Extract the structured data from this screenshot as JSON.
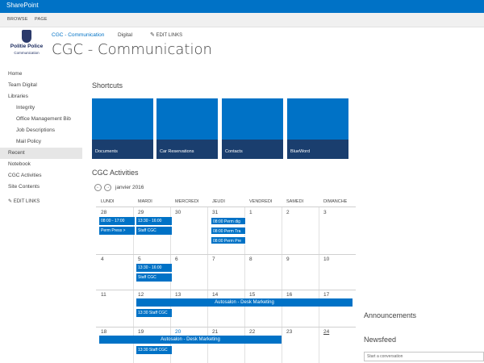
{
  "suite": {
    "title": "SharePoint"
  },
  "ribbon": {
    "tabs": [
      "BROWSE",
      "PAGE"
    ]
  },
  "logo": {
    "line1": "Politie Police",
    "line2": "Communication"
  },
  "topnav": {
    "items": [
      "CGC - Communication",
      "Digital"
    ],
    "edit": "EDIT LINKS"
  },
  "site": {
    "title": "CGC - Communication"
  },
  "leftnav": {
    "items": [
      {
        "label": "Home",
        "level": "top"
      },
      {
        "label": "Team Digital",
        "level": "top"
      },
      {
        "label": "Libraries",
        "level": "top"
      },
      {
        "label": "Integrity",
        "level": "sub"
      },
      {
        "label": "Office Management Bib",
        "level": "sub"
      },
      {
        "label": "Job Descriptions",
        "level": "sub"
      },
      {
        "label": "Mail Policy",
        "level": "sub"
      },
      {
        "label": "Recent",
        "level": "top",
        "selected": true
      },
      {
        "label": "Notebook",
        "level": "top"
      },
      {
        "label": "CGC Activities",
        "level": "top"
      },
      {
        "label": "Site Contents",
        "level": "top"
      }
    ],
    "edit": "EDIT LINKS"
  },
  "shortcuts": {
    "title": "Shortcuts",
    "tiles": [
      "Documents",
      "Car Reservations",
      "Contacts",
      "BlueWord"
    ],
    "color": "#0072c6",
    "caption_color": "#1a3e6e"
  },
  "calendar": {
    "title": "CGC Activities",
    "month": "janvier 2016",
    "prev": "←",
    "next": "→",
    "days": [
      "LUNDI",
      "MARDI",
      "MERCREDI",
      "JEUDI",
      "VENDREDI",
      "SAMEDI",
      "DIMANCHE"
    ],
    "weeks": [
      [
        "28",
        "29",
        "30",
        "31",
        "1",
        "2",
        "3"
      ],
      [
        "4",
        "5",
        "6",
        "7",
        "8",
        "9",
        "10"
      ],
      [
        "11",
        "12",
        "13",
        "14",
        "15",
        "16",
        "17"
      ],
      [
        "18",
        "19",
        "20",
        "21",
        "22",
        "23",
        "24"
      ]
    ],
    "events": [
      {
        "text": "08:00 - 17:00",
        "week": 0,
        "day": 0,
        "row": 0
      },
      {
        "text": "Perm Press >",
        "week": 0,
        "day": 0,
        "row": 1
      },
      {
        "text": "13:30 - 16:00",
        "week": 0,
        "day": 1,
        "row": 0
      },
      {
        "text": "Staff CGC",
        "week": 0,
        "day": 1,
        "row": 1
      },
      {
        "text": "08:00 Perm dig",
        "week": 0,
        "day": 3,
        "row": 0,
        "outlined": true
      },
      {
        "text": "08:00 Perm Tra",
        "week": 0,
        "day": 3,
        "row": 1,
        "outlined": true
      },
      {
        "text": "08:00 Perm Pre",
        "week": 0,
        "day": 3,
        "row": 2,
        "outlined": true
      },
      {
        "text": "13:30 - 16:00",
        "week": 1,
        "day": 1,
        "row": 0
      },
      {
        "text": "Staff CGC",
        "week": 1,
        "day": 1,
        "row": 1
      },
      {
        "text": "13:30 Staff CGC",
        "week": 2,
        "day": 1,
        "row": 1
      },
      {
        "text": "13:30 Staff CGC",
        "week": 3,
        "day": 1,
        "row": 1
      }
    ],
    "span_events": [
      {
        "text": "Autosalon - Desk Marketing",
        "week": 2,
        "start": 1,
        "end": 7
      },
      {
        "text": "Autosalon - Desk Marketing",
        "week": 3,
        "start": 0,
        "end": 5
      }
    ],
    "today_label": "20",
    "underlined_label": "24"
  },
  "rightpanel": {
    "announcements": "Announcements",
    "newsfeed": "Newsfeed",
    "conversation_placeholder": "Start a conversation"
  }
}
